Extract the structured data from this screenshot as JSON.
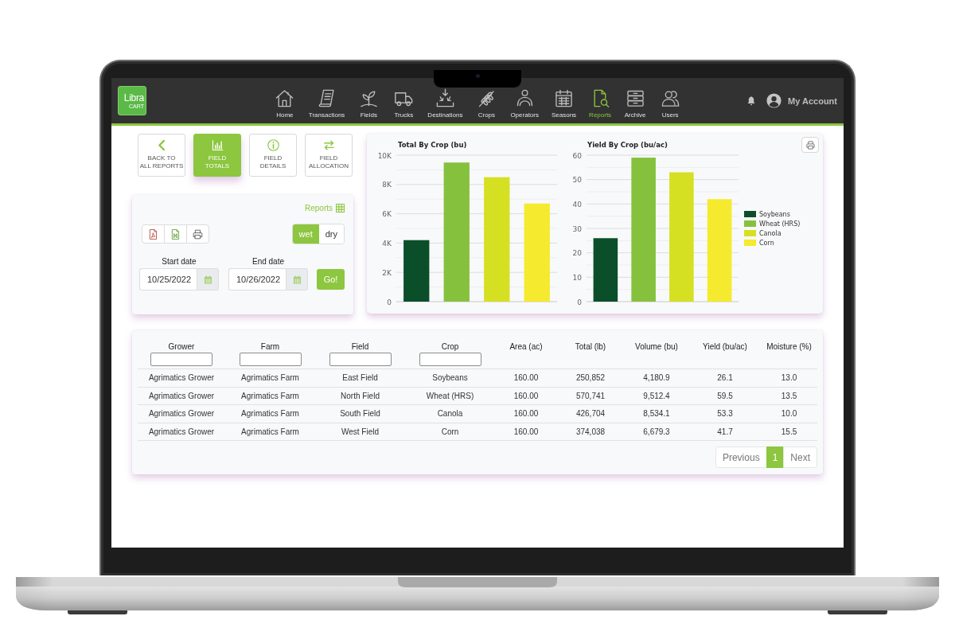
{
  "nav": {
    "logo": {
      "wordmark": "Libra",
      "tagline": "CART"
    },
    "items": [
      {
        "label": "Home",
        "selected": false
      },
      {
        "label": "Transactions",
        "selected": false
      },
      {
        "label": "Fields",
        "selected": false
      },
      {
        "label": "Trucks",
        "selected": false
      },
      {
        "label": "Destinations",
        "selected": false
      },
      {
        "label": "Crops",
        "selected": false
      },
      {
        "label": "Operators",
        "selected": false
      },
      {
        "label": "Seasons",
        "selected": false
      },
      {
        "label": "Reports",
        "selected": true
      },
      {
        "label": "Archive",
        "selected": false
      },
      {
        "label": "Users",
        "selected": false
      }
    ],
    "account": "My Account"
  },
  "report_buttons": [
    {
      "label": "BACK TO\nALL REPORTS",
      "selected": false
    },
    {
      "label": "FIELD\nTOTALS",
      "selected": true
    },
    {
      "label": "FIELD\nDETAILS",
      "selected": false
    },
    {
      "label": "FIELD\nALLOCATION",
      "selected": false
    }
  ],
  "filter_panel": {
    "reports_link": "Reports",
    "units": [
      {
        "label": "wet",
        "selected": true
      },
      {
        "label": "dry",
        "selected": false
      }
    ],
    "start_date": {
      "label": "Start date",
      "value": "10/25/2022"
    },
    "end_date": {
      "label": "End date",
      "value": "10/26/2022"
    },
    "go_button": "Go!"
  },
  "charts_panel": {
    "charts": [
      {
        "chart_data": {
          "type": "bar",
          "title": "Total By Crop (bu)",
          "grid": true,
          "series": [
            {
              "color": "#0b4f2a",
              "values": [
                4200
              ]
            },
            {
              "color": "#86c13d",
              "values": [
                9500
              ]
            },
            {
              "color": "#d6e023",
              "values": [
                8500
              ]
            },
            {
              "color": "#f5ea2e",
              "values": [
                6700
              ]
            }
          ],
          "ylim": [
            0,
            10000
          ],
          "yticks": [
            {
              "value": 0,
              "label": "0"
            },
            {
              "value": 2000,
              "label": "2K"
            },
            {
              "value": 4000,
              "label": "4K"
            },
            {
              "value": 6000,
              "label": "6K"
            },
            {
              "value": 8000,
              "label": "8K"
            },
            {
              "value": 10000,
              "label": "10K"
            }
          ]
        }
      },
      {
        "chart_data": {
          "type": "bar",
          "title": "Yield By Crop (bu/ac)",
          "grid": true,
          "series": [
            {
              "name": "Soybeans",
              "color": "#0b4f2a",
              "values": [
                26
              ]
            },
            {
              "name": "Wheat (HRS)",
              "color": "#86c13d",
              "values": [
                59
              ]
            },
            {
              "name": "Canola",
              "color": "#d6e023",
              "values": [
                53
              ]
            },
            {
              "name": "Corn",
              "color": "#f5ea2e",
              "values": [
                42
              ]
            }
          ],
          "ylim": [
            0,
            60
          ],
          "yticks": [
            0,
            10,
            20,
            30,
            40,
            50,
            60
          ]
        }
      }
    ]
  },
  "table": {
    "columns": [
      {
        "label": "Grower",
        "filterable": true
      },
      {
        "label": "Farm",
        "filterable": true
      },
      {
        "label": "Field",
        "filterable": true
      },
      {
        "label": "Crop",
        "filterable": true
      },
      {
        "label": "Area (ac)",
        "filterable": false
      },
      {
        "label": "Total (lb)",
        "filterable": false
      },
      {
        "label": "Volume (bu)",
        "filterable": false
      },
      {
        "label": "Yield (bu/ac)",
        "filterable": false
      },
      {
        "label": "Moisture (%)",
        "filterable": false
      }
    ],
    "rows": [
      [
        "Agrimatics Grower",
        "Agrimatics Farm",
        "East Field",
        "Soybeans",
        "160.00",
        "250,852",
        "4,180.9",
        "26.1",
        "13.0"
      ],
      [
        "Agrimatics Grower",
        "Agrimatics Farm",
        "North Field",
        "Wheat (HRS)",
        "160.00",
        "570,741",
        "9,512.4",
        "59.5",
        "13.5"
      ],
      [
        "Agrimatics Grower",
        "Agrimatics Farm",
        "South Field",
        "Canola",
        "160.00",
        "426,704",
        "8,534.1",
        "53.3",
        "10.0"
      ],
      [
        "Agrimatics Grower",
        "Agrimatics Farm",
        "West Field",
        "Corn",
        "160.00",
        "374,038",
        "6,679.3",
        "41.7",
        "15.5"
      ]
    ]
  },
  "pagination": {
    "previous": "Previous",
    "pages": [
      {
        "label": "1",
        "selected": true
      }
    ],
    "next": "Next"
  }
}
